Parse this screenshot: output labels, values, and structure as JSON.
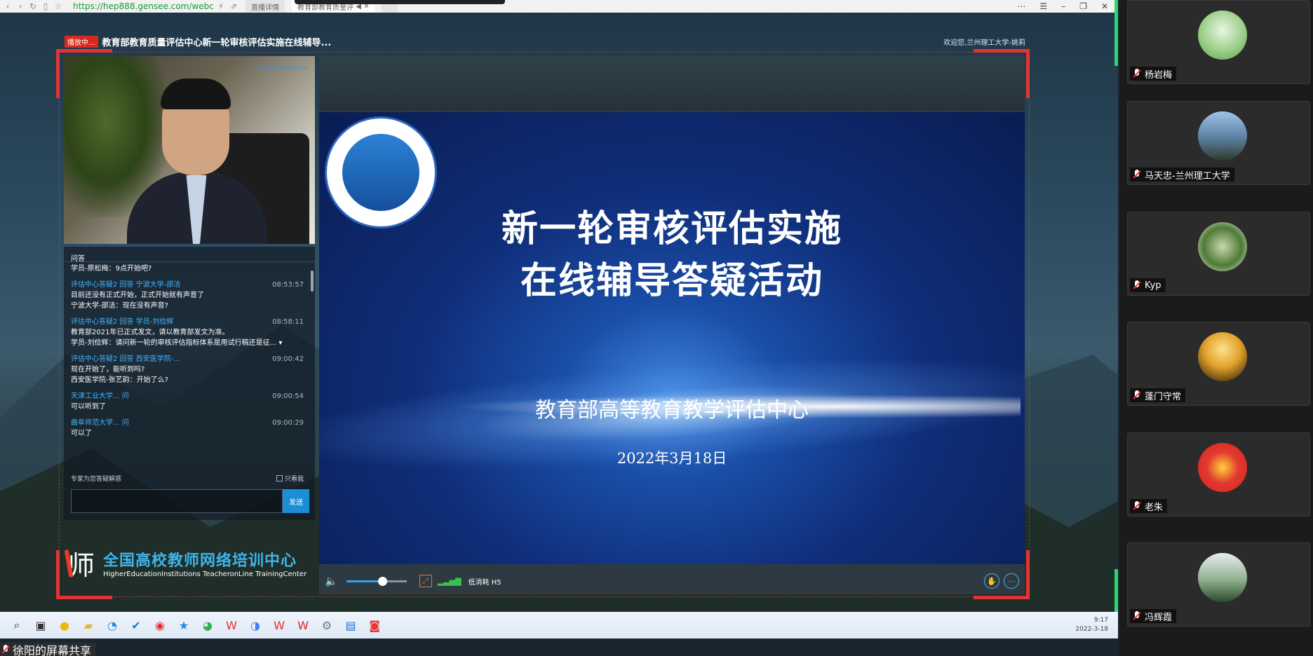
{
  "browser": {
    "url": "https://hep888.gensee.com/webca",
    "tabs": [
      {
        "label": "直播详情"
      },
      {
        "label": "教育部教育质量评"
      }
    ]
  },
  "page": {
    "live_badge": "播放中...",
    "title": "教育部教育质量评估中心新一轮审核评估实施在线辅导...",
    "welcome": "欢迎您,兰州理工大学-姚莉"
  },
  "qa": {
    "header": "问答",
    "items": [
      {
        "head": "",
        "time": "",
        "lines": [
          "学员-原松梅：9点开始吧?"
        ]
      },
      {
        "head": "评估中心答疑2   回答   宁波大学-邵洁",
        "time": "08:53:57",
        "lines": [
          "目前还没有正式开始，正式开始就有声音了",
          "宁波大学-邵洁：现在没有声音?"
        ]
      },
      {
        "head": "评估中心答疑2   回答   学员-刘俭辉",
        "time": "08:58:11",
        "lines": [
          "教育部2021年已正式发文，请以教育部发文为准。",
          "学员-刘俭辉：请问新一轮的审核评估指标体系是用试行稿还是征..."
        ]
      },
      {
        "head": "评估中心答疑2   回答   西安医学院-...",
        "time": "09:00:42",
        "lines": [
          "现在开始了，能听到吗?",
          "西安医学院-张艺韵：开始了么?"
        ]
      },
      {
        "head": "天津工业大学...   问",
        "time": "09:00:54",
        "lines": [
          "可以听到了"
        ]
      },
      {
        "head": "曲阜师范大学...   问",
        "time": "09:00:29",
        "lines": [
          "可以了"
        ]
      }
    ],
    "footer_label": "专家为您答疑解惑",
    "only_me": "只看我",
    "input_value": "",
    "send": "发送"
  },
  "brand": {
    "mark": "师",
    "name_cn": "全国高校教师网络培训中心",
    "name_en": "HigherEducationInstitutions TeacheronLine TrainingCenter"
  },
  "video": {
    "logo_text": "全国高校教师网络培训中心"
  },
  "slide": {
    "title_line1": "新一轮审核评估实施",
    "title_line2": "在线辅导答疑活动",
    "org": "教育部高等教育教学评估中心",
    "date": "2022年3月18日"
  },
  "player": {
    "volume": 0.6,
    "quality": "低消耗 H5"
  },
  "taskbar": {
    "time": "9:17",
    "date": "2022-3-18"
  },
  "share_caption": "徐阳的屏幕共享",
  "participants": [
    {
      "name": "杨岩梅"
    },
    {
      "name": "马天忠-兰州理工大学"
    },
    {
      "name": "Kyp"
    },
    {
      "name": "蓬门守常"
    },
    {
      "name": "老朱"
    },
    {
      "name": "冯辉霞"
    }
  ],
  "colors": {
    "accent_blue": "#1a8fd6",
    "live_red": "#d9281e",
    "frame_red": "#e23434",
    "online_green": "#2ed573"
  }
}
